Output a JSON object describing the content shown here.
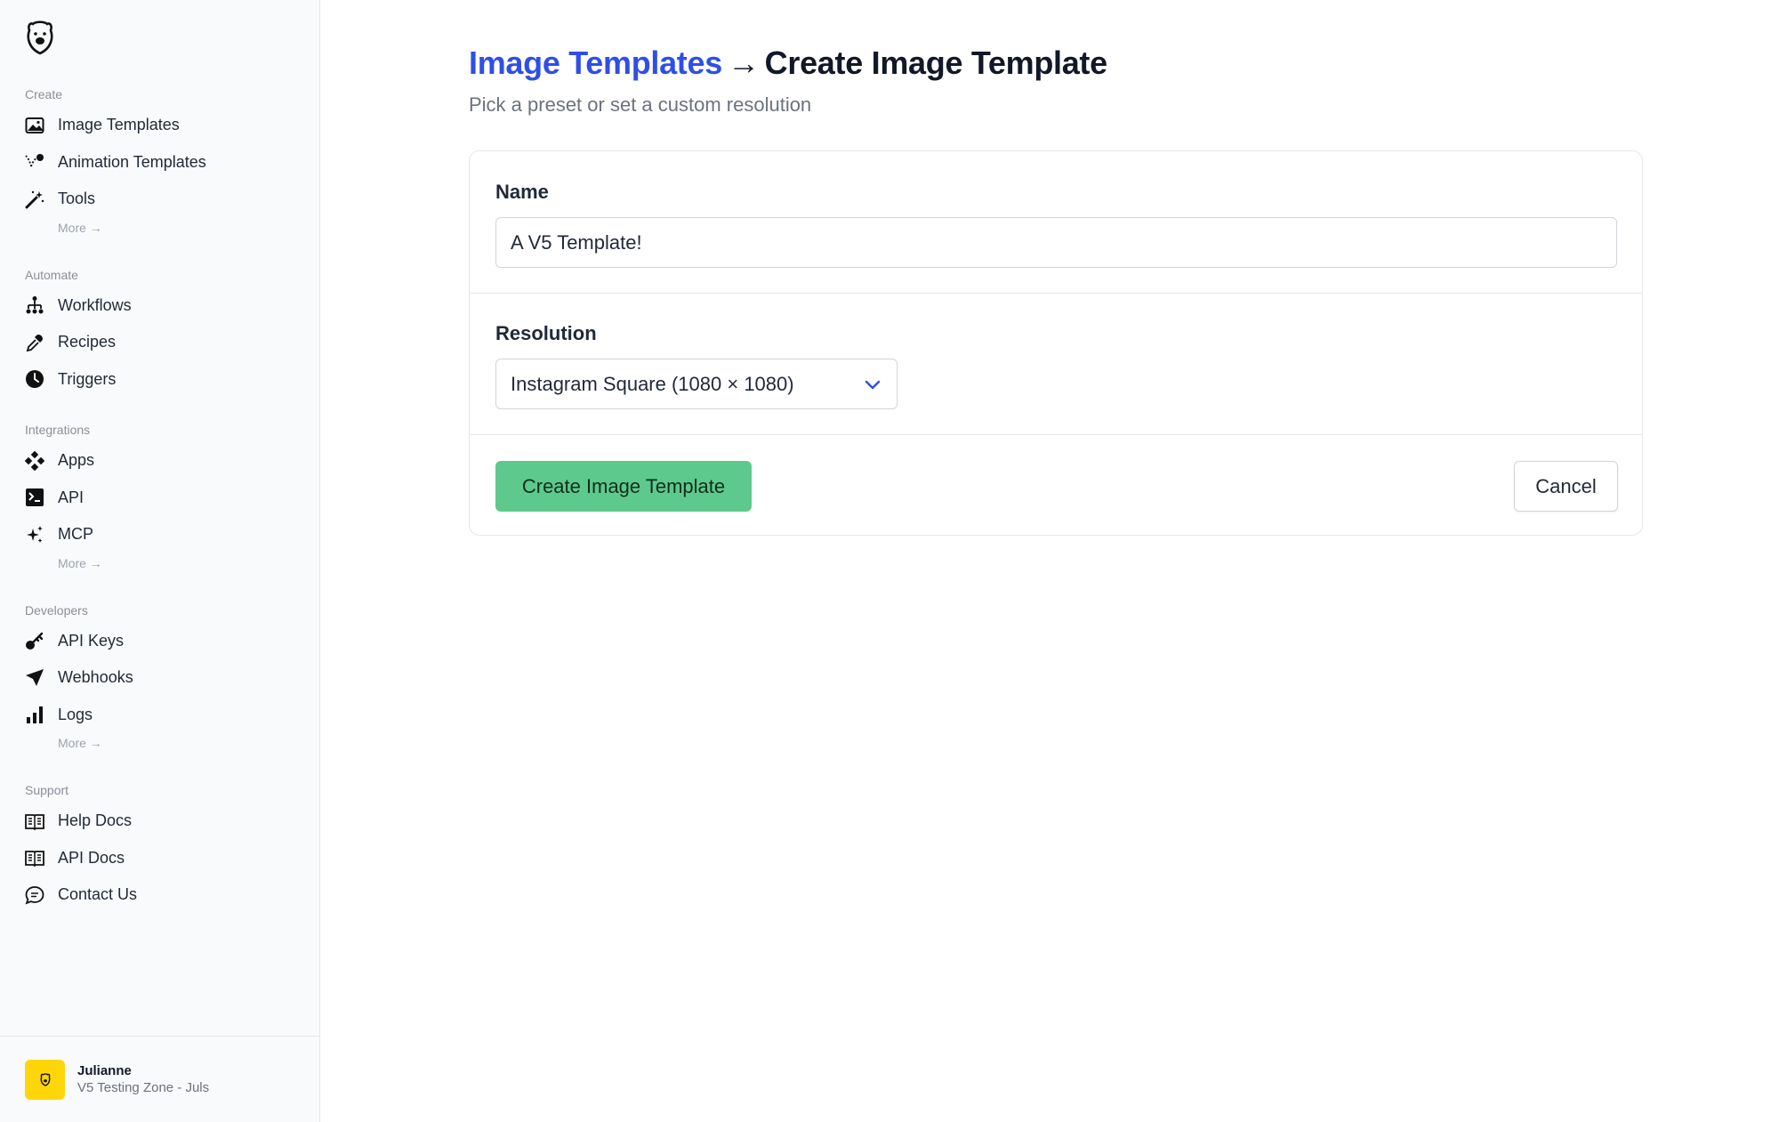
{
  "sidebar": {
    "sections": {
      "create": {
        "label": "Create",
        "items": [
          "Image Templates",
          "Animation Templates",
          "Tools"
        ],
        "more": "More →"
      },
      "automate": {
        "label": "Automate",
        "items": [
          "Workflows",
          "Recipes",
          "Triggers"
        ]
      },
      "integrations": {
        "label": "Integrations",
        "items": [
          "Apps",
          "API",
          "MCP"
        ],
        "more": "More →"
      },
      "developers": {
        "label": "Developers",
        "items": [
          "API Keys",
          "Webhooks",
          "Logs"
        ],
        "more": "More →"
      },
      "support": {
        "label": "Support",
        "items": [
          "Help Docs",
          "API Docs",
          "Contact Us"
        ]
      }
    },
    "user": {
      "name": "Julianne",
      "team": "V5 Testing Zone - Juls"
    }
  },
  "header": {
    "breadcrumb_link": "Image Templates",
    "arrow": "→",
    "current": "Create Image Template",
    "subtitle": "Pick a preset or set a custom resolution"
  },
  "form": {
    "name_label": "Name",
    "name_value": "A V5 Template!",
    "resolution_label": "Resolution",
    "resolution_value": "Instagram Square (1080 × 1080)",
    "create_button": "Create Image Template",
    "cancel_button": "Cancel"
  },
  "colors": {
    "accent_link": "#2f4ee8",
    "primary_button": "#5ec98c",
    "avatar": "#ffd60a"
  }
}
